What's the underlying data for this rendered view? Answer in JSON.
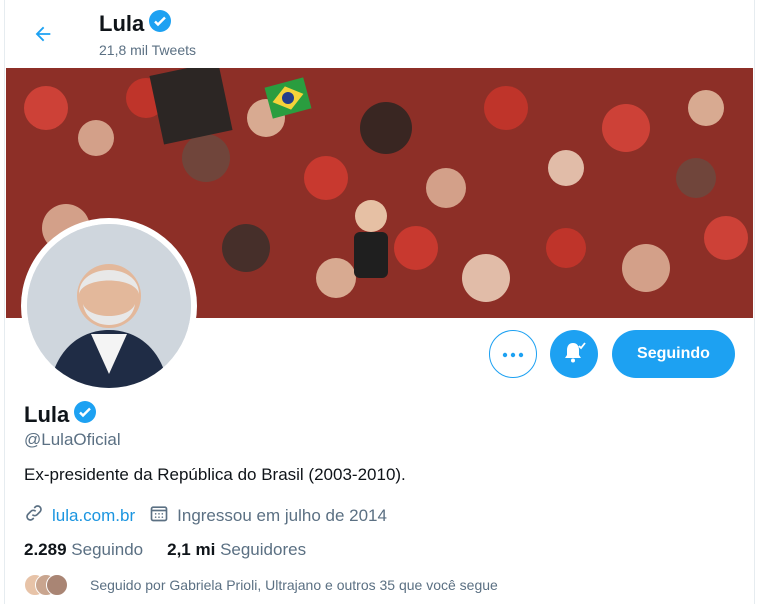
{
  "header": {
    "title": "Lula",
    "tweet_count": "21,8 mil Tweets"
  },
  "profile": {
    "name": "Lula",
    "handle": "@LulaOficial",
    "bio": "Ex-presidente da República do Brasil (2003-2010).",
    "website": "lula.com.br",
    "joined": "Ingressou em julho de 2014",
    "following_count": "2.289",
    "following_label": "Seguindo",
    "followers_count": "2,1 mi",
    "followers_label": "Seguidores",
    "followed_by": "Seguido por Gabriela Prioli, Ultrajano e outros 35 que você segue"
  },
  "actions": {
    "follow_label": "Seguindo"
  },
  "colors": {
    "accent": "#1da1f2",
    "verified": "#1da1f2",
    "secondary_text": "#5b7083"
  }
}
